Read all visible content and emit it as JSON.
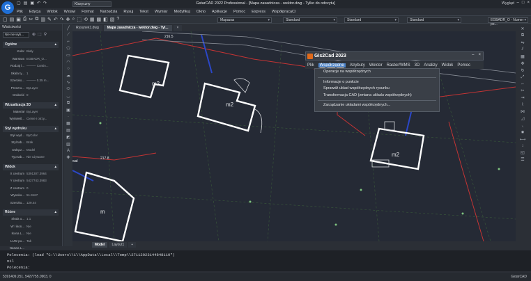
{
  "title_bar": {
    "logo": "G",
    "workspace": "Klasyczny",
    "title": "GstarCAD 2022 Professional - [Mapa zasadnicza - wektor.dwg - Tylko do odczytu]",
    "search": "Wygląd",
    "controls": [
      "–",
      "□",
      "×"
    ]
  },
  "menu": [
    "Plik",
    "Edycja",
    "Widok",
    "Wstaw",
    "Format",
    "Narzędzia",
    "Rysuj",
    "Tekst",
    "Wymiar",
    "Modyfikuj",
    "Okno",
    "Aplikacje",
    "Pomoc",
    "Express",
    "WspółpracaCl"
  ],
  "toolbar": {
    "layer_select": "Mapazas",
    "style1": "Standard",
    "style2": "Standard",
    "style3": "Standard",
    "extra_select": "EGBADR_O - Numer po..."
  },
  "left_panel": {
    "title": "Właściwości",
    "selection": "Nie nie wyb...",
    "sections": [
      {
        "name": "Ogólne",
        "rows": [
          {
            "k": "Kolor",
            "v": "Biały"
          },
          {
            "k": "Warstwa",
            "v": "EGBADR_O..."
          },
          {
            "k": "Rodzaj l...",
            "v": "——— Contin..."
          },
          {
            "k": "Skala ty...",
            "v": "1"
          },
          {
            "k": "Szeroko...",
            "v": "——— 0.35 m..."
          },
          {
            "k": "Przezro...",
            "v": "ByLayer"
          },
          {
            "k": "Grubość",
            "v": "0"
          }
        ]
      },
      {
        "name": "Wizualizacja 3D",
        "rows": [
          {
            "k": "Materiał",
            "v": "ByLayer"
          },
          {
            "k": "Wyświetl...",
            "v": "Cienie i otrzy..."
          }
        ]
      },
      {
        "name": "Styl wydruku",
        "rows": [
          {
            "k": "Styl wyd...",
            "v": "ByColor"
          },
          {
            "k": "Styl tab...",
            "v": "Brak"
          },
          {
            "k": "Dołącz...",
            "v": "Model"
          },
          {
            "k": "Typ tab...",
            "v": "Nie używane"
          }
        ]
      },
      {
        "name": "Widok",
        "rows": [
          {
            "k": "X centrum",
            "v": "5391307.3964"
          },
          {
            "k": "Y centrum",
            "v": "5427743.3983"
          },
          {
            "k": "Z centrum",
            "v": "0"
          },
          {
            "k": "Wysoko...",
            "v": "51.9167"
          },
          {
            "k": "Szeroko...",
            "v": "129.44"
          }
        ]
      },
      {
        "name": "Różne",
        "rows": [
          {
            "k": "Skala o...",
            "v": "1:1"
          },
          {
            "k": "W l ikon...",
            "v": "Nie"
          },
          {
            "k": "Ikona L...",
            "v": "Nie"
          },
          {
            "k": "LUW po...",
            "v": "Tak"
          },
          {
            "k": "Nazwa L...",
            "v": ""
          }
        ]
      }
    ]
  },
  "tabs": [
    "Rysunek1.dwg",
    "Mapa zasadnicza - wektor.dwg - Tyl...",
    "×"
  ],
  "drawing": {
    "labels": [
      "m2",
      "m2",
      "m2",
      "m",
      "216.5",
      "217.8",
      "wał"
    ],
    "building_tag": "m2"
  },
  "model_tabs": [
    "Model",
    "Layout1",
    "+"
  ],
  "gis2cad": {
    "title": "Gis2Cad 2023",
    "menu": [
      "Plik",
      "Współrzędne",
      "Atrybuty",
      "Wektor",
      "Raster/WMS",
      "3D",
      "Analizy",
      "Widok",
      "Pomoc"
    ],
    "active_menu": "Współrzędne",
    "dropdown": [
      "Operacje na współrzędnych",
      "Informacje o punkcie",
      "Sprawdź układ współrzędnych rysunku",
      "Transformacja CAD (zmiana układu współrzędnych)",
      "Zarządzanie układami współrzędnych..."
    ]
  },
  "command_line": [
    "Polecenia: (load \"C:\\\\Users\\\\1\\\\AppData\\\\Local\\\\Temp\\\\27112023144848110\")",
    "nil",
    "Polecenia:"
  ],
  "status": {
    "coords": "5391409.251, 5427755.0903, 0",
    "brand": "GstarCAD"
  },
  "colors": {
    "canvas": "#252a35",
    "panel": "#262a30",
    "accent": "#4d84c9",
    "brand_orange": "#e06a1a",
    "red_line": "#c53434",
    "blue_line": "#2b47c7"
  }
}
